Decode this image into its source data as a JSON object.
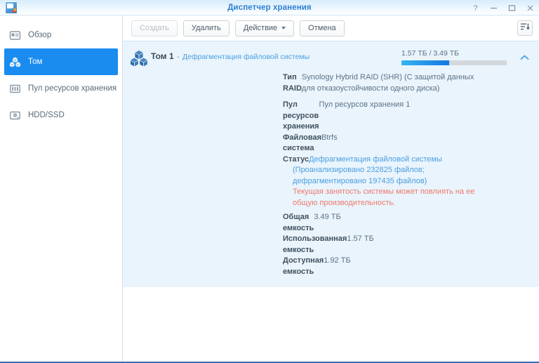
{
  "window": {
    "title": "Диспетчер хранения",
    "app_icon": "storage-manager-icon",
    "controls": {
      "help": "?",
      "minimize": "−",
      "maximize": "□",
      "close": "×"
    }
  },
  "sidebar": {
    "items": [
      {
        "label": "Обзор",
        "icon": "overview-icon",
        "active": false
      },
      {
        "label": "Том",
        "icon": "volume-cubes-icon",
        "active": true
      },
      {
        "label": "Пул ресурсов хранения",
        "icon": "storage-pool-icon",
        "active": false
      },
      {
        "label": "HDD/SSD",
        "icon": "hdd-icon",
        "active": false
      }
    ]
  },
  "toolbar": {
    "create_label": "Создать",
    "create_disabled": true,
    "delete_label": "Удалить",
    "action_label": "Действие",
    "cancel_label": "Отмена",
    "sort_icon": "sort-descending-icon"
  },
  "volume": {
    "icon": "volume-cubes-icon",
    "name": "Том 1",
    "separator": "-",
    "status_link": "Дефрагментация файловой системы",
    "capacity_summary": "1.57 ТБ / 3.49 ТБ",
    "usage_percent": 45,
    "collapse_icon": "chevron-up-icon",
    "rows": [
      {
        "label": "Тип RAID",
        "value": "Synology Hybrid RAID (SHR) (С защитой данных для отказоустойчивости одного диска)",
        "style": "plain"
      },
      {
        "label": "Пул ресурсов хранения",
        "value": "Пул ресурсов хранения 1",
        "style": "plain"
      },
      {
        "label": "Файловая система",
        "value": "Btrfs",
        "style": "plain"
      },
      {
        "label": "Статус",
        "value": "Дефрагментация файловой системы",
        "style": "link"
      }
    ],
    "status_detail": "(Проанализировано 232825 файлов; дефрагментировано 197435 файлов)",
    "status_warning": "Текущая занятость системы может повлиять на ее общую производительность.",
    "capacity_rows": [
      {
        "label": "Общая емкость",
        "value": "3.49 ТБ"
      },
      {
        "label": "Использованная емкость",
        "value": "1.57 ТБ"
      },
      {
        "label": "Доступная емкость",
        "value": "1.92 ТБ"
      }
    ]
  },
  "colors": {
    "accent": "#1a8cf0",
    "title": "#2b7fd4",
    "link": "#4a9fe0",
    "warning": "#f0796c",
    "card_bg": "#e9f4fc"
  }
}
